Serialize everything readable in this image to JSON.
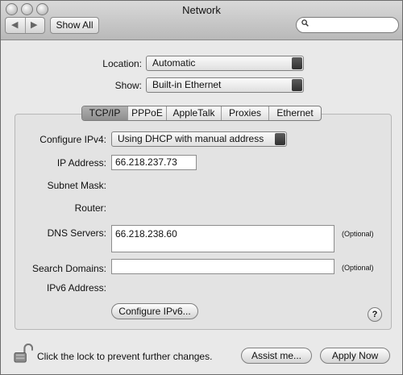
{
  "window": {
    "title": "Network"
  },
  "toolbar": {
    "back_icon": "left-arrow-icon",
    "forward_icon": "right-arrow-icon",
    "show_all_label": "Show All",
    "search_placeholder": ""
  },
  "location": {
    "label": "Location:",
    "value": "Automatic"
  },
  "show": {
    "label": "Show:",
    "value": "Built-in Ethernet"
  },
  "tabs": [
    {
      "label": "TCP/IP",
      "selected": true
    },
    {
      "label": "PPPoE",
      "selected": false
    },
    {
      "label": "AppleTalk",
      "selected": false
    },
    {
      "label": "Proxies",
      "selected": false
    },
    {
      "label": "Ethernet",
      "selected": false
    }
  ],
  "tcpip": {
    "configure_label": "Configure IPv4:",
    "configure_value": "Using DHCP with manual address",
    "ip_label": "IP Address:",
    "ip_value": "66.218.237.73",
    "subnet_label": "Subnet Mask:",
    "router_label": "Router:",
    "dns_label": "DNS Servers:",
    "dns_value": "66.218.238.60",
    "dns_optional": "(Optional)",
    "search_domains_label": "Search Domains:",
    "search_domains_value": "",
    "search_optional": "(Optional)",
    "ipv6_label": "IPv6 Address:",
    "configure_ipv6_label": "Configure IPv6..."
  },
  "help": {
    "label": "?"
  },
  "footer": {
    "lock_message": "Click the lock to prevent further changes.",
    "assist_label": "Assist me...",
    "apply_label": "Apply Now"
  }
}
